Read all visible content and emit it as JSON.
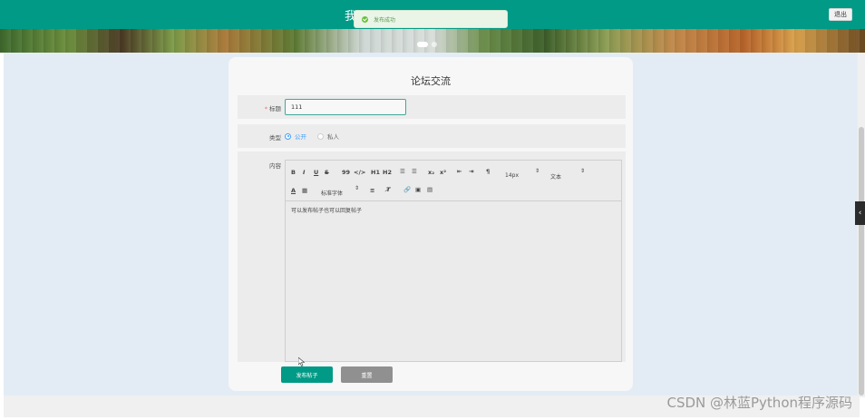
{
  "header": {
    "title_fragment": "我",
    "logout_label": "退出"
  },
  "toast": {
    "message": "发布成功"
  },
  "form": {
    "title": "论坛交流",
    "fields": {
      "title_label": "标题",
      "title_value": "111",
      "type_label": "类型",
      "type_options": [
        "公开",
        "私人"
      ],
      "type_selected": "公开",
      "content_label": "内容",
      "content_text": "可以发布帖子也可以回复帖子"
    },
    "toolbar": {
      "row1": [
        "B",
        "I",
        "U",
        "S",
        "99",
        "</>",
        "H1",
        "H2",
        "☰",
        "☰",
        "x₂",
        "x²",
        "⇤",
        "⇥",
        "¶"
      ],
      "font_size": "14px",
      "paragraph": "文本",
      "font_family": "标准字体"
    },
    "buttons": {
      "submit": "发布帖子",
      "reset": "重置"
    }
  },
  "watermark": "CSDN @林蓝Python程序源码"
}
